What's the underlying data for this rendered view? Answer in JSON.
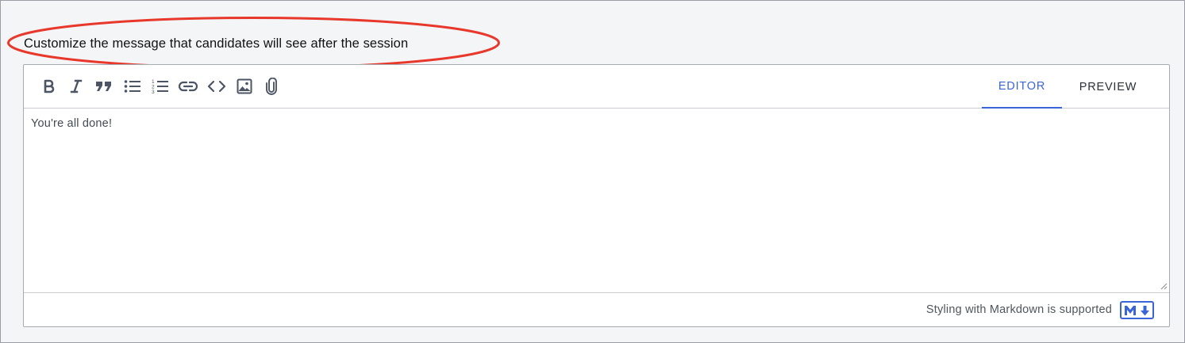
{
  "prompt": {
    "label": "Customize the message that candidates will see after the session"
  },
  "toolbar": {
    "tools": [
      {
        "name": "bold",
        "icon": "bold-icon"
      },
      {
        "name": "italic",
        "icon": "italic-icon"
      },
      {
        "name": "quote",
        "icon": "quote-icon"
      },
      {
        "name": "bulleted-list",
        "icon": "bulleted-list-icon"
      },
      {
        "name": "numbered-list",
        "icon": "numbered-list-icon"
      },
      {
        "name": "link",
        "icon": "link-icon"
      },
      {
        "name": "code",
        "icon": "code-icon"
      },
      {
        "name": "image",
        "icon": "image-icon"
      },
      {
        "name": "attachment",
        "icon": "paperclip-icon"
      }
    ],
    "tabs": {
      "editor": "EDITOR",
      "preview": "PREVIEW",
      "active": "editor"
    }
  },
  "editor": {
    "value": "You're all done!"
  },
  "footer": {
    "markdown_note": "Styling with Markdown is supported",
    "badge_icon": "markdown-icon"
  },
  "colors": {
    "accent": "#3b64d8",
    "annotation": "#e8382b",
    "background": "#f4f5f7",
    "border": "#a6abb2"
  }
}
